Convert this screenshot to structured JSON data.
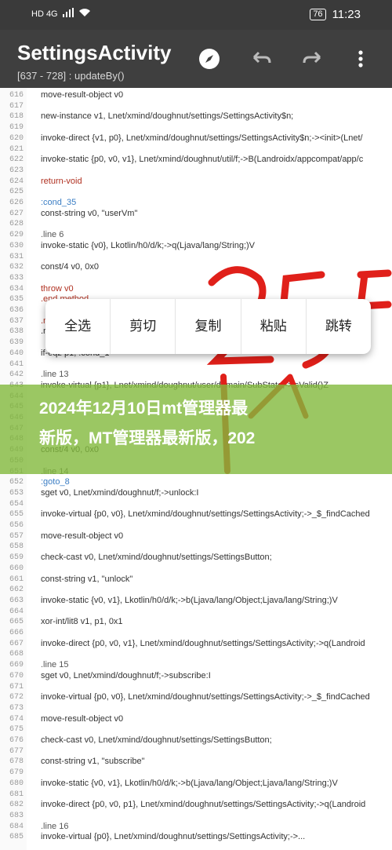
{
  "status": {
    "left": "HD 4G",
    "battery": "76",
    "time": "11:23"
  },
  "appbar": {
    "title": "SettingsActivity",
    "subtitle": "[637 - 728] : updateBy()",
    "icons": [
      "compass-icon",
      "undo-icon",
      "redo-icon",
      "more-icon"
    ]
  },
  "code": {
    "lines": [
      {
        "num": "616",
        "text": "move-result-object  v0"
      },
      {
        "num": "617",
        "text": ""
      },
      {
        "num": "618",
        "text": "new-instance  v1,  Lnet/xmind/doughnut/settings/SettingsActivity$n;"
      },
      {
        "num": "619",
        "text": ""
      },
      {
        "num": "620",
        "text": "invoke-direct  {v1,  p0},  Lnet/xmind/doughnut/settings/SettingsActivity$n;-><init>(Lnet/"
      },
      {
        "num": "621",
        "text": ""
      },
      {
        "num": "622",
        "text": "invoke-static  {p0,  v0,  v1},  Lnet/xmind/doughnut/util/f;->B(Landroidx/appcompat/app/c"
      },
      {
        "num": "623",
        "text": ""
      },
      {
        "num": "624",
        "text": "return-void"
      },
      {
        "num": "625",
        "text": ""
      },
      {
        "num": "626",
        "text": ":cond_35"
      },
      {
        "num": "627",
        "text": "const-string  v0,  \"userVm\""
      },
      {
        "num": "628",
        "text": ""
      },
      {
        "num": "629",
        "text": ".line  6"
      },
      {
        "num": "630",
        "text": "invoke-static  {v0},  Lkotlin/h0/d/k;->q(Ljava/lang/String;)V"
      },
      {
        "num": "631",
        "text": ""
      },
      {
        "num": "632",
        "text": "const/4  v0,  0x0"
      },
      {
        "num": "633",
        "text": ""
      },
      {
        "num": "634",
        "text": "throw  v0"
      },
      {
        "num": "635",
        "text": ".end method"
      },
      {
        "num": "636",
        "text": ""
      },
      {
        "num": "637",
        "text": ".method"
      },
      {
        "num": "638",
        "text": "  .r"
      },
      {
        "num": "639",
        "text": ""
      },
      {
        "num": "640",
        "text": "if-eqz  p1,  :cond_1"
      },
      {
        "num": "641",
        "text": ""
      },
      {
        "num": "642",
        "text": ".line  13"
      },
      {
        "num": "643",
        "text": "invoke-virtual  {p1},  Lnet/xmind/doughnut/user/domain/SubState;->isValid()Z"
      },
      {
        "num": "644",
        "text": ""
      },
      {
        "num": "645",
        "text": ""
      },
      {
        "num": "646",
        "text": ""
      },
      {
        "num": "647",
        "text": ""
      },
      {
        "num": "648",
        "text": ""
      },
      {
        "num": "649",
        "text": "const/4  v0,  0x0"
      },
      {
        "num": "650",
        "text": ""
      },
      {
        "num": "651",
        "text": ".line  14"
      },
      {
        "num": "652",
        "text": ":goto_8"
      },
      {
        "num": "653",
        "text": "sget  v0,  Lnet/xmind/doughnut/f;->unlock:I"
      },
      {
        "num": "654",
        "text": ""
      },
      {
        "num": "655",
        "text": "invoke-virtual  {p0,  v0},  Lnet/xmind/doughnut/settings/SettingsActivity;->_$_findCached"
      },
      {
        "num": "656",
        "text": ""
      },
      {
        "num": "657",
        "text": "move-result-object  v0"
      },
      {
        "num": "658",
        "text": ""
      },
      {
        "num": "659",
        "text": "check-cast  v0,  Lnet/xmind/doughnut/settings/SettingsButton;"
      },
      {
        "num": "660",
        "text": ""
      },
      {
        "num": "661",
        "text": "const-string  v1,  \"unlock\""
      },
      {
        "num": "662",
        "text": ""
      },
      {
        "num": "663",
        "text": "invoke-static  {v0,  v1},  Lkotlin/h0/d/k;->b(Ljava/lang/Object;Ljava/lang/String;)V"
      },
      {
        "num": "664",
        "text": ""
      },
      {
        "num": "665",
        "text": "xor-int/lit8  v1,  p1,  0x1"
      },
      {
        "num": "666",
        "text": ""
      },
      {
        "num": "667",
        "text": "invoke-direct  {p0,  v0,  v1},  Lnet/xmind/doughnut/settings/SettingsActivity;->q(Landroid"
      },
      {
        "num": "668",
        "text": ""
      },
      {
        "num": "669",
        "text": ".line  15"
      },
      {
        "num": "670",
        "text": "sget  v0,  Lnet/xmind/doughnut/f;->subscribe:I"
      },
      {
        "num": "671",
        "text": ""
      },
      {
        "num": "672",
        "text": "invoke-virtual  {p0,  v0},  Lnet/xmind/doughnut/settings/SettingsActivity;->_$_findCached"
      },
      {
        "num": "673",
        "text": ""
      },
      {
        "num": "674",
        "text": "move-result-object  v0"
      },
      {
        "num": "675",
        "text": ""
      },
      {
        "num": "676",
        "text": "check-cast  v0,  Lnet/xmind/doughnut/settings/SettingsButton;"
      },
      {
        "num": "677",
        "text": ""
      },
      {
        "num": "678",
        "text": "const-string  v1,  \"subscribe\""
      },
      {
        "num": "679",
        "text": ""
      },
      {
        "num": "680",
        "text": "invoke-static  {v0,  v1},  Lkotlin/h0/d/k;->b(Ljava/lang/Object;Ljava/lang/String;)V"
      },
      {
        "num": "681",
        "text": ""
      },
      {
        "num": "682",
        "text": "invoke-direct  {p0,  v0,  p1},  Lnet/xmind/doughnut/settings/SettingsActivity;->q(Landroid"
      },
      {
        "num": "683",
        "text": ""
      },
      {
        "num": "684",
        "text": ".line  16"
      },
      {
        "num": "685",
        "text": "invoke-virtual  {p0},  Lnet/xmind/doughnut/settings/SettingsActivity;->..."
      }
    ]
  },
  "context_menu": {
    "items": [
      "全选",
      "剪切",
      "复制",
      "粘贴",
      "跳转"
    ]
  },
  "banner": {
    "line1": "2024年12月10日mt管理器最",
    "line2": "新版，MT管理器最新版，202"
  },
  "colors": {
    "appbar": "#3f3f3f",
    "statusbar": "#3a3a3a",
    "banner": "#82b93c",
    "scribble": "#e0201a"
  }
}
